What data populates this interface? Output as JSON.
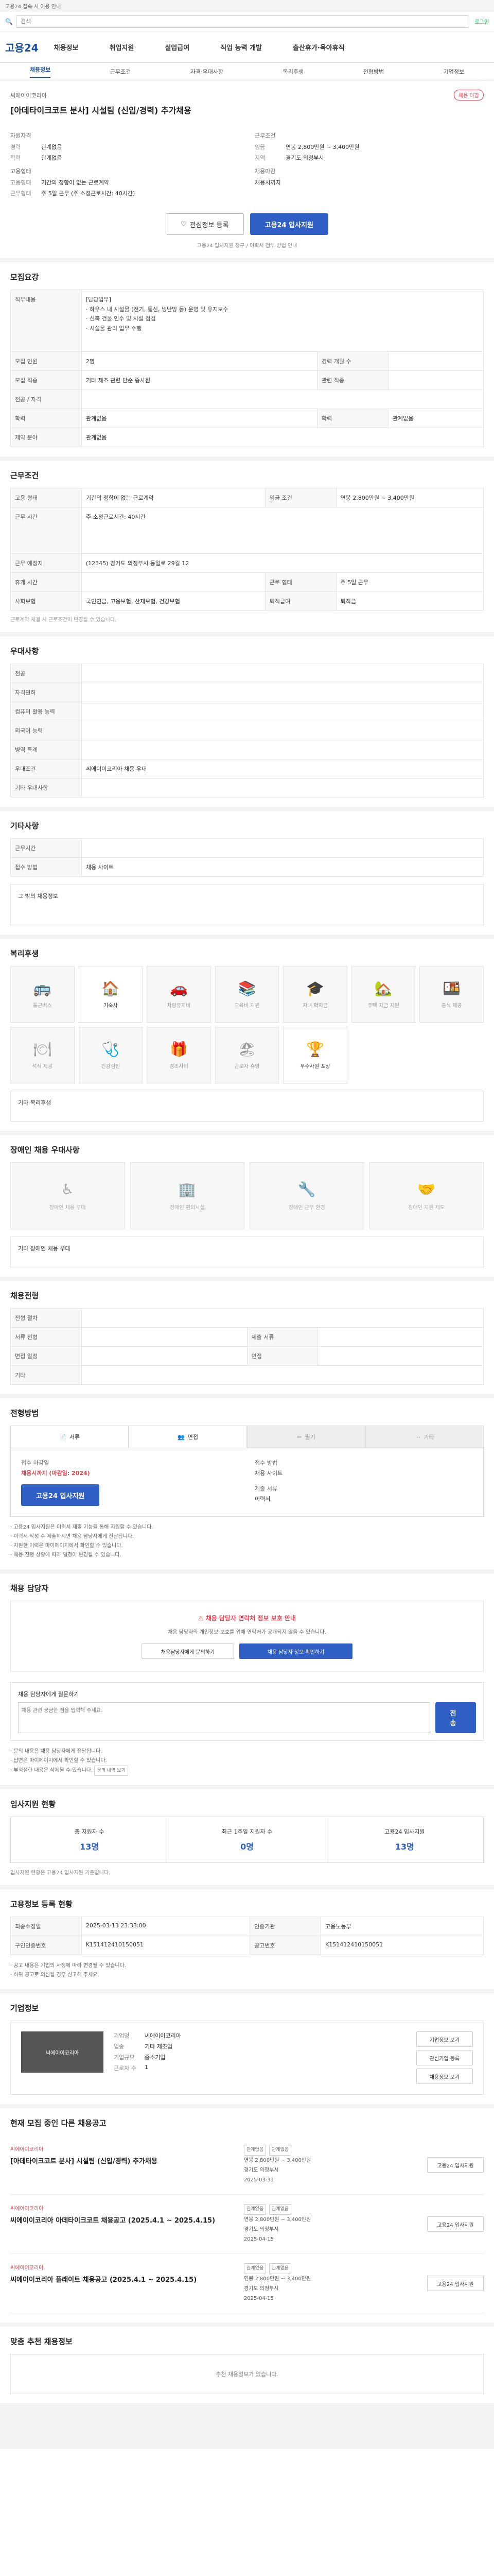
{
  "top": {
    "notice": "고용24 접속 시 이용 안내",
    "login": "로그인"
  },
  "search": {
    "placeholder": "검색"
  },
  "gnb": {
    "logo": "고용24",
    "items": [
      "채용정보",
      "취업지원",
      "실업급여",
      "직업 능력 개발",
      "출산휴가·육아휴직"
    ]
  },
  "subnav": [
    "채용정보",
    "근무조건",
    "자격·우대사항",
    "복리후생",
    "전형방법",
    "기업정보"
  ],
  "job": {
    "company": "씨에이이코리아",
    "title": "[아데타이크코트 분사] 시설팀 (신입/경력) 추가채용",
    "badge": "채용 마감",
    "qual_label": "자원자격",
    "career_label": "경력",
    "career": "관계없음",
    "edu_label": "학력",
    "edu": "관계없음",
    "emp_label": "고용형태",
    "emp_type_label": "고용형태",
    "emp_type": "기간의 정함이 없는 근로계약",
    "work_type_label": "근무형태",
    "work_type": "주 5일 근무 (주 소정근로시간: 40시간)",
    "cond_label": "근무조건",
    "wage_label": "임금",
    "wage": "연봉 2,800만원 ~ 3,400만원",
    "loc_label": "지역",
    "loc": "경기도 의정부시",
    "period_label": "채용마감",
    "period": "채용시까지"
  },
  "actions": {
    "favorite": "관심정보 등록",
    "apply": "고용24 입사지원",
    "note": "고용24 입사지원 창구 / 이력서 첨부 방법 안내"
  },
  "recruit": {
    "title": "모집요강",
    "duty_label": "직무내용",
    "duty_text": "[담당업무]\n· 하우스 내 시설물 (전기, 통신, 냉난방 등) 운영 및 유지보수\n· 신축 건물 인수 및 시설 점검\n· 시설물 관리 업무 수행",
    "rows": [
      [
        "모집 인원",
        "2명",
        "경력 개월 수",
        ""
      ],
      [
        "모집 직종",
        "기타 제조 관련 단순 종사원",
        "관련 직종",
        ""
      ],
      [
        "전공 / 자격",
        "",
        "",
        ""
      ],
      [
        "학력",
        "관계없음",
        "학력",
        "관계없음"
      ],
      [
        "제약 분야",
        "관계없음",
        "",
        ""
      ]
    ]
  },
  "conditions": {
    "title": "근무조건",
    "rows": [
      [
        "고용 형태",
        "기간의 정함이 없는 근로계약",
        "임금 조건",
        "연봉 2,800만원 ~ 3,400만원"
      ],
      [
        "근무 시간",
        "주 소정근로시간: 40시간",
        "",
        ""
      ],
      [
        "근무 예정지",
        "(12345) 경기도 의정부시 동일로 29길 12",
        "",
        ""
      ],
      [
        "휴게 시간",
        "",
        "근로 형태",
        "주 5일 근무"
      ],
      [
        "사회보험",
        "국민연금, 고용보험, 산재보험, 건강보험",
        "퇴직급여",
        "퇴직금"
      ]
    ],
    "note": "근로계약 체결 시 근로조건이 변경될 수 있습니다."
  },
  "prefer": {
    "title": "우대사항",
    "rows": [
      [
        "전공",
        ""
      ],
      [
        "자격면허",
        ""
      ],
      [
        "컴퓨터 활용 능력",
        ""
      ],
      [
        "외국어 능력",
        ""
      ],
      [
        "병역 특례",
        ""
      ],
      [
        "우대조건",
        "씨에이이코리아 채용 우대"
      ],
      [
        "기타 우대사항",
        ""
      ]
    ]
  },
  "other": {
    "title": "기타사항",
    "rows": [
      [
        "근무시간",
        ""
      ],
      [
        "접수 방법",
        "채용 사이트"
      ]
    ],
    "extra_label": "그 밖의 채용정보"
  },
  "welfare": {
    "title": "복리후생",
    "items": [
      {
        "label": "통근버스",
        "icon": "bus-icon",
        "on": false
      },
      {
        "label": "기숙사",
        "icon": "house-icon",
        "on": true
      },
      {
        "label": "차량유지비",
        "icon": "car-icon",
        "on": false
      },
      {
        "label": "교육비 지원",
        "icon": "book-icon",
        "on": false
      },
      {
        "label": "자녀 학자금",
        "icon": "graduation-icon",
        "on": false
      },
      {
        "label": "주택 자금 지원",
        "icon": "home-icon",
        "on": false
      },
      {
        "label": "중식 제공",
        "icon": "meal-icon",
        "on": false
      },
      {
        "label": "석식 제공",
        "icon": "dinner-icon",
        "on": false
      },
      {
        "label": "건강검진",
        "icon": "health-icon",
        "on": false
      },
      {
        "label": "경조사비",
        "icon": "gift-icon",
        "on": false
      },
      {
        "label": "근로자 휴양",
        "icon": "beach-icon",
        "on": false
      },
      {
        "label": "우수사원 포상",
        "icon": "trophy-icon",
        "on": true
      }
    ],
    "etc_label": "기타 복리후생"
  },
  "disability": {
    "title": "장애인 채용 우대사항",
    "items": [
      "장애인 채용 우대",
      "장애인 편의시설",
      "장애인 근무 환경",
      "장애인 지원 제도"
    ],
    "etc_label": "기타 장애인 채용 우대"
  },
  "process": {
    "title": "채용전형",
    "rows": [
      [
        "전형 절차",
        ""
      ],
      [
        "서류 전형",
        "",
        "제출 서류",
        ""
      ],
      [
        "면접 일정",
        "",
        "면접",
        ""
      ],
      [
        "기타",
        "",
        "",
        ""
      ]
    ]
  },
  "apply": {
    "title": "전형방법",
    "methods": [
      {
        "label": "서류",
        "icon": "document-icon",
        "on": true
      },
      {
        "label": "면접",
        "icon": "interview-icon",
        "on": true
      },
      {
        "label": "필기",
        "icon": "pencil-icon",
        "on": false
      },
      {
        "label": "기타",
        "icon": "more-icon",
        "on": false
      }
    ],
    "deadline_label": "접수 마감일",
    "deadline": "채용시까지 (마감일: 2024)",
    "method_label": "접수 방법",
    "method_val": "채용 사이트",
    "docs_label": "제출 서류",
    "docs_val": "이력서",
    "button": "고용24 입사지원",
    "bullets": [
      "고용24 입사지원은 이력서 제출 기능을 통해 지원할 수 있습니다.",
      "이력서 작성 후 제출하시면 채용 담당자에게 전달됩니다.",
      "지원한 이력은 마이페이지에서 확인할 수 있습니다.",
      "채용 진행 상황에 따라 일정이 변경될 수 있습니다."
    ]
  },
  "contact": {
    "title": "채용 담당자",
    "notice_red": "채용 담당자 연락처 정보 보호 안내",
    "notice_text": "채용 담당자의 개인정보 보호를 위해 연락처가 공개되지 않을 수 있습니다.",
    "btn1": "채용담당자에게 문의하기",
    "btn2": "채용 담당자 정보 확인하기",
    "inquiry_label": "채용 담당자에게 질문하기",
    "inquiry_placeholder": "채용 관련 궁금한 점을 입력해 주세요.",
    "inquiry_button": "전송",
    "bullets": [
      "문의 내용은 채용 담당자에게 전달됩니다.",
      "답변은 마이페이지에서 확인할 수 있습니다.",
      "부적절한 내용은 삭제될 수 있습니다."
    ],
    "small_btn": "문의 내역 보기"
  },
  "stats": {
    "title": "입사지원 현황",
    "items": [
      {
        "label": "총 지원자 수",
        "value": "13명"
      },
      {
        "label": "최근 1주일 지원자 수",
        "value": "0명"
      },
      {
        "label": "고용24 입사지원",
        "value": "13명"
      }
    ],
    "note": "입사지원 현황은 고용24 입사지원 기준입니다."
  },
  "reg": {
    "title": "고용정보 등록 현황",
    "rows": [
      [
        "최종수정일",
        "2025-03-13 23:33:00",
        "인증기관",
        "고용노동부"
      ],
      [
        "구인인증번호",
        "K151412410150051",
        "공고번호",
        "K151412410150051"
      ]
    ],
    "notes": [
      "공고 내용은 기업의 사정에 따라 변경될 수 있습니다.",
      "허위 공고로 의심될 경우 신고해 주세요."
    ]
  },
  "company": {
    "title": "기업정보",
    "logo_text": "씨에이이코리아",
    "name_label": "기업명",
    "name": "씨에이이코리아",
    "type_label": "업종",
    "type": "기타 제조업",
    "size_label": "기업규모",
    "size": "중소기업",
    "emp_label": "근로자 수",
    "emp": "1",
    "btn1": "기업정보 보기",
    "btn2": "관심기업 등록",
    "btn3": "채용정보 보기"
  },
  "similar": {
    "title": "현재 모집 중인 다른 채용공고",
    "items": [
      {
        "company": "씨에이이코리아",
        "title": "[아데타이크코트 분사] 시설팀 (신입/경력) 추가채용",
        "career": "관계없음",
        "edu": "관계없음",
        "wage": "연봉 2,800만원 ~ 3,400만원",
        "loc": "경기도 의정부시",
        "deadline": "2025-03-31"
      },
      {
        "company": "씨에이이코리아",
        "title": "씨에이이코리아 아데타이크코트 채용공고 (2025.4.1 ~ 2025.4.15)",
        "career": "관계없음",
        "edu": "관계없음",
        "wage": "연봉 2,800만원 ~ 3,400만원",
        "loc": "경기도 의정부시",
        "deadline": "2025-04-15"
      },
      {
        "company": "씨에이이코리아",
        "title": "씨에이이코리아 플래이트 채용공고 (2025.4.1 ~ 2025.4.15)",
        "career": "관계없음",
        "edu": "관계없음",
        "wage": "연봉 2,800만원 ~ 3,400만원",
        "loc": "경기도 의정부시",
        "deadline": "2025-04-15"
      }
    ],
    "apply_btn": "고용24 입사지원"
  },
  "recommend": {
    "title": "맞춤 추천 채용정보",
    "empty": "추천 채용정보가 없습니다."
  }
}
